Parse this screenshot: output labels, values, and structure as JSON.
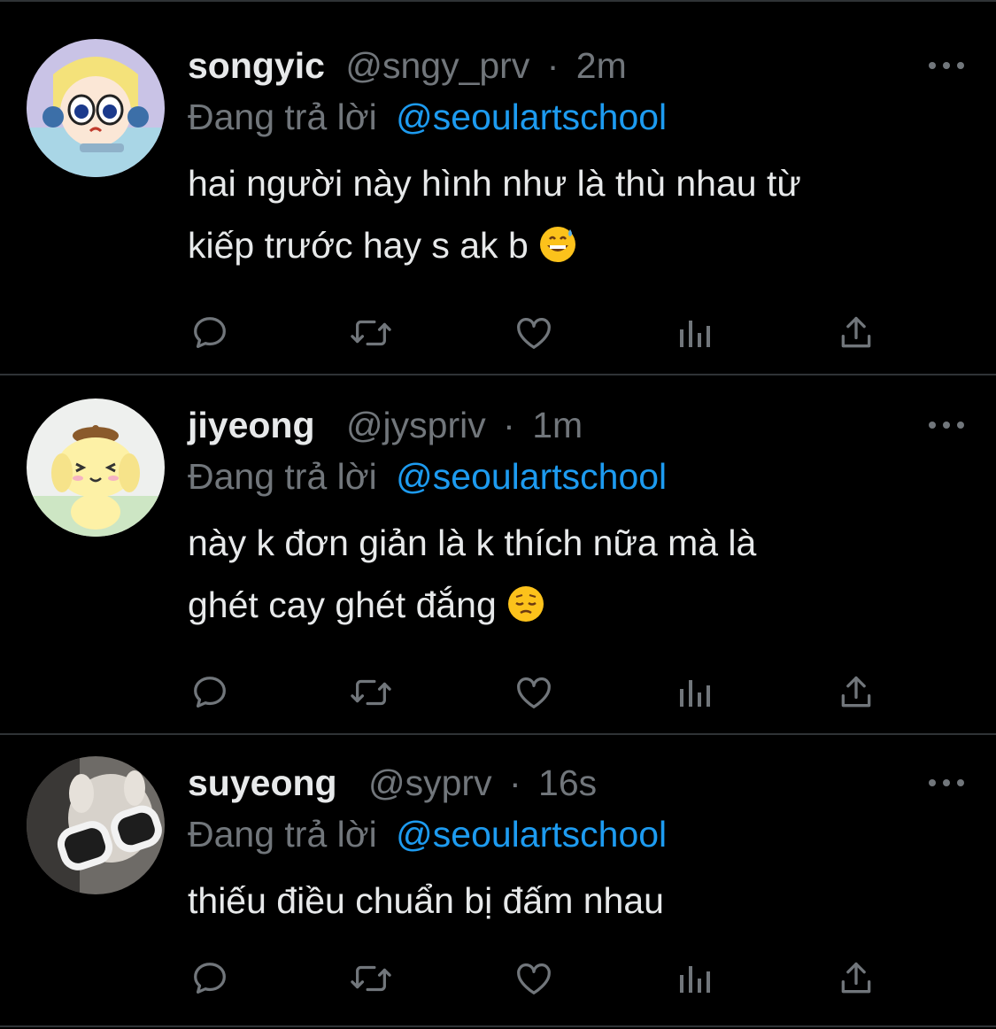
{
  "colors": {
    "background": "#000000",
    "divider": "#2f3336",
    "primary_text": "#e7e9ea",
    "secondary_text": "#71767b",
    "mention": "#1d9bf0"
  },
  "actions": [
    "reply-icon",
    "retweet-icon",
    "like-icon",
    "analytics-icon",
    "share-icon"
  ],
  "tweets": [
    {
      "name": "songyic",
      "handle": "@sngy_prv",
      "sep": "·",
      "time": "2m",
      "reply_label": "Đang trả lời",
      "reply_to": "@seoulartschool",
      "text_line1": "hai người này hình như là thù nhau từ",
      "text_line2": "kiếp trước hay s ak b",
      "emoji": "grinning-face-with-sweat"
    },
    {
      "name": "jiyeong",
      "handle": "@jyspriv",
      "sep": "·",
      "time": "1m",
      "reply_label": "Đang trả lời",
      "reply_to": "@seoulartschool",
      "text_line1": "này k đơn giản là k thích nữa mà là",
      "text_line2": "ghét cay ghét đắng",
      "emoji": "pensive-face"
    },
    {
      "name": "suyeong",
      "handle": "@syprv",
      "sep": "·",
      "time": "16s",
      "reply_label": "Đang trả lời",
      "reply_to": "@seoulartschool",
      "text_line1": "thiếu điều chuẩn bị đấm nhau",
      "text_line2": "",
      "emoji": ""
    }
  ]
}
